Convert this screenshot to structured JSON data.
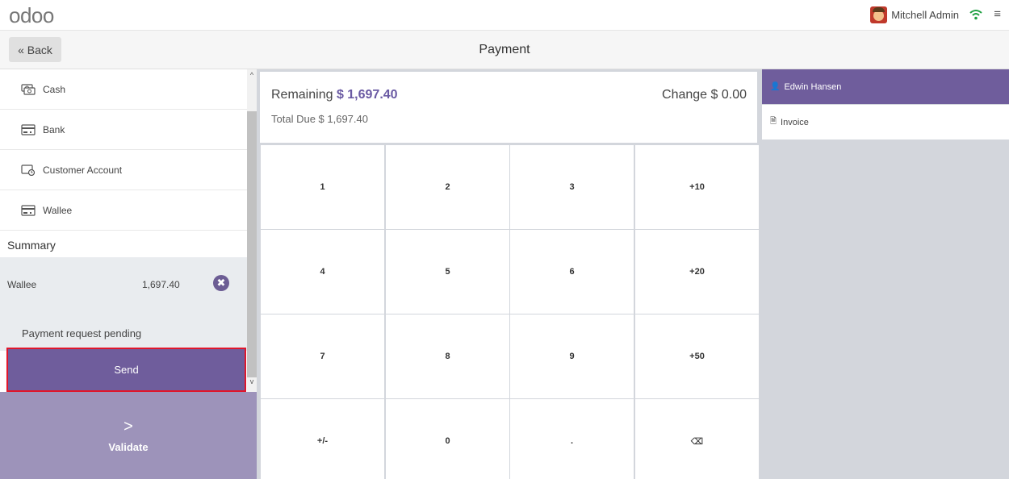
{
  "topbar": {
    "logo": "odoo",
    "user_name": "Mitchell Admin",
    "wifi_icon": "wifi-icon",
    "menu_icon": "hamburger-menu-icon",
    "menu_glyph": "≡"
  },
  "header": {
    "back_label": "« Back",
    "title": "Payment"
  },
  "payment_methods": [
    {
      "label": "Cash",
      "icon": "cash-icon"
    },
    {
      "label": "Bank",
      "icon": "bank-card-icon"
    },
    {
      "label": "Customer Account",
      "icon": "customer-account-icon"
    },
    {
      "label": "Wallee",
      "icon": "card-terminal-icon"
    }
  ],
  "summary": {
    "label": "Summary",
    "line": {
      "method": "Wallee",
      "amount": "1,697.40",
      "remove_glyph": "✖"
    },
    "pending_text": "Payment request pending",
    "send_label": "Send"
  },
  "validate": {
    "chevron": ">",
    "label": "Validate"
  },
  "scrollbar": {
    "up": "^",
    "down": "v"
  },
  "amounts": {
    "remaining_label": "Remaining",
    "remaining_value": "$ 1,697.40",
    "change_text": "Change $ 0.00",
    "total_due_text": "Total Due $ 1,697.40"
  },
  "keypad": [
    "1",
    "2",
    "3",
    "+10",
    "4",
    "5",
    "6",
    "+20",
    "7",
    "8",
    "9",
    "+50",
    "+/-",
    "0",
    ".",
    "⌫"
  ],
  "right_panel": {
    "customer_name": "Edwin Hansen",
    "customer_icon_glyph": "👤",
    "invoice_label": "Invoice",
    "invoice_icon_glyph": "🗎"
  },
  "colors": {
    "accent": "#6f5d9c",
    "validate_bg": "#9d93ba",
    "highlight_border": "#e0162b",
    "panel_bg": "#d3d6dc"
  }
}
